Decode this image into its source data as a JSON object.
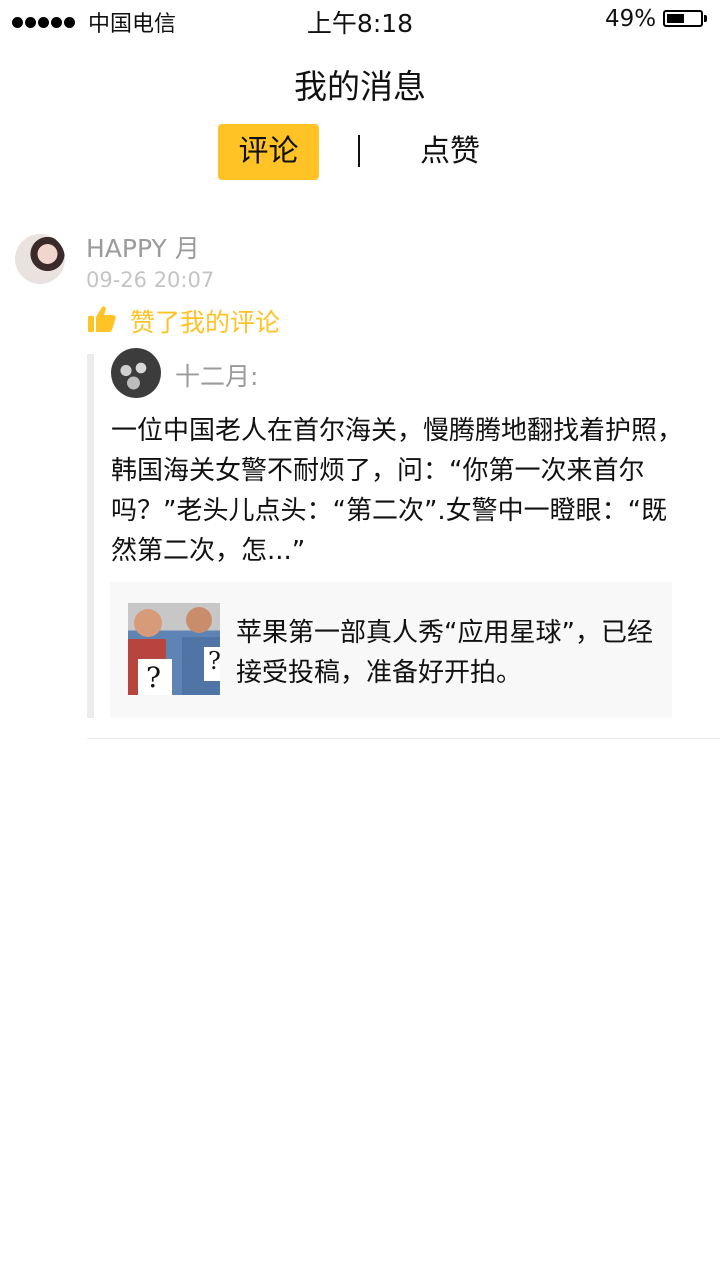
{
  "status_bar": {
    "carrier": "中国电信",
    "time": "上午8:18",
    "battery": "49%"
  },
  "header": {
    "title": "我的消息"
  },
  "tabs": [
    {
      "label": "评论",
      "active": true
    },
    {
      "label": "点赞",
      "active": false
    }
  ],
  "accent_color": "#ffc326",
  "message": {
    "username": "HAPPY 月",
    "timestamp": "09-26 20:07",
    "action": "赞了我的评论",
    "original": {
      "author": "十二月:",
      "body": "一位中国老人在首尔海关，慢腾腾地翻找着护照，韩国海关女警不耐烦了，问：“你第一次来首尔吗？”老头儿点头：“第二次”.女警中一瞪眼：“既然第二次，怎...”",
      "article_title": "苹果第一部真人秀“应用星球”，已经接受投稿，准备好开拍。"
    }
  }
}
